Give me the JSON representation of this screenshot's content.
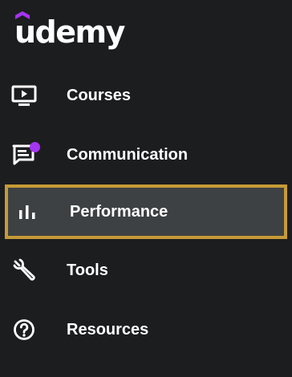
{
  "brand": {
    "name": "udemy",
    "accent_color": "#a435f0"
  },
  "nav": {
    "items": [
      {
        "label": "Courses",
        "icon": "tv-play-icon",
        "active": false
      },
      {
        "label": "Communication",
        "icon": "chat-icon",
        "active": false,
        "notification": true
      },
      {
        "label": "Performance",
        "icon": "bar-chart-icon",
        "active": true
      },
      {
        "label": "Tools",
        "icon": "wrench-icon",
        "active": false
      },
      {
        "label": "Resources",
        "icon": "help-circle-icon",
        "active": false
      }
    ]
  },
  "colors": {
    "background": "#1c1d1f",
    "active_background": "#3e4143",
    "active_border": "#c59a37",
    "text": "#ffffff"
  }
}
